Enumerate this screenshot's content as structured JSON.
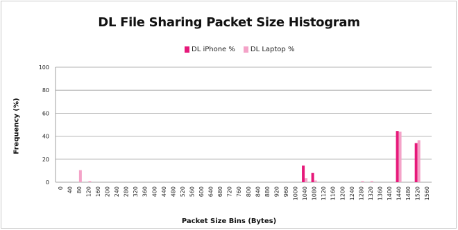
{
  "chart_data": {
    "type": "bar",
    "title": "DL File Sharing Packet Size Histogram",
    "xlabel": "Packet Size Bins (Bytes)",
    "ylabel": "Frequency (%)",
    "ylim": [
      0,
      100
    ],
    "yticks": [
      0,
      20,
      40,
      60,
      80,
      100
    ],
    "grid": true,
    "legend_position": "top",
    "categories": [
      "0",
      "40",
      "80",
      "120",
      "160",
      "200",
      "240",
      "280",
      "320",
      "360",
      "400",
      "440",
      "480",
      "520",
      "560",
      "600",
      "640",
      "680",
      "720",
      "760",
      "800",
      "840",
      "880",
      "920",
      "960",
      "1000",
      "1040",
      "1080",
      "1120",
      "1160",
      "1200",
      "1240",
      "1280",
      "1320",
      "1360",
      "1400",
      "1440",
      "1480",
      "1520",
      "1560"
    ],
    "series": [
      {
        "name": "DL iPhone %",
        "color": "#e6197a",
        "values": [
          0,
          0,
          0,
          0,
          0,
          0,
          0,
          0,
          0,
          0,
          0,
          0,
          0,
          0,
          0,
          0,
          0,
          0,
          0,
          0,
          0,
          0,
          0,
          0,
          0,
          0,
          14.5,
          8,
          0,
          0,
          0,
          0,
          0,
          0,
          0,
          0,
          44.5,
          0,
          34,
          0
        ]
      },
      {
        "name": "DL Laptop %",
        "color": "#f4a3c8",
        "values": [
          0,
          0,
          10.5,
          1,
          0,
          0,
          0,
          0,
          0,
          0,
          0,
          0,
          0,
          0,
          0,
          0,
          0,
          0,
          0,
          0,
          0,
          0,
          0,
          0,
          0,
          0,
          3.5,
          1.5,
          0,
          0,
          0,
          0,
          1,
          1,
          0,
          0,
          44,
          0,
          36.5,
          0
        ]
      }
    ]
  }
}
